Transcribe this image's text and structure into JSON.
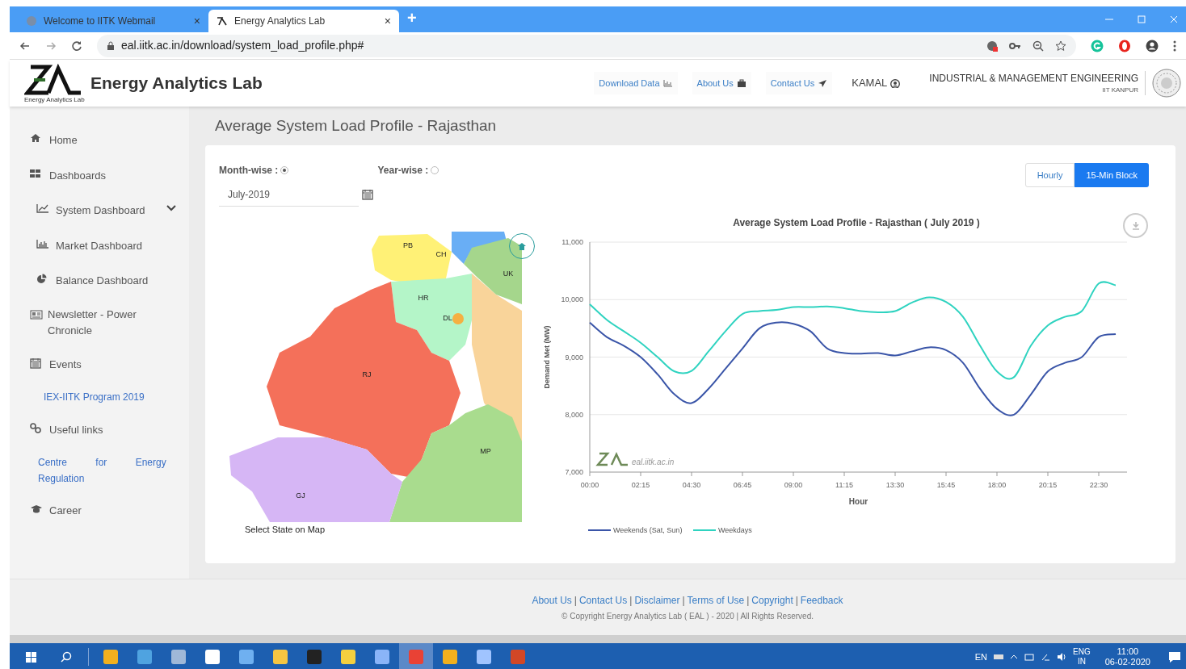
{
  "browser": {
    "tabs": [
      {
        "title": "Welcome to IITK Webmail",
        "selected": false
      },
      {
        "title": "Energy Analytics Lab",
        "selected": true
      }
    ],
    "tab_close": "×",
    "new_tab": "+",
    "url": "eal.iitk.ac.in/download/system_load_profile.php#"
  },
  "header": {
    "brand": "Energy Analytics Lab",
    "logo_caption": "Energy Analytics Lab",
    "nav": [
      {
        "label": "Download Data",
        "kind": "chart"
      },
      {
        "label": "About Us",
        "kind": "briefcase"
      },
      {
        "label": "Contact Us",
        "kind": "plane"
      },
      {
        "label": "KAMAL",
        "kind": "user"
      }
    ],
    "department": "INDUSTRIAL & MANAGEMENT ENGINEERING",
    "institute": "IIT KANPUR"
  },
  "sidebar": {
    "items": [
      {
        "label": "Home",
        "kind": "item"
      },
      {
        "label": "Dashboards",
        "kind": "item"
      },
      {
        "label": "System Dashboard",
        "kind": "sub",
        "expanded": false
      },
      {
        "label": "Market Dashboard",
        "kind": "sub"
      },
      {
        "label": "Balance Dashboard",
        "kind": "sub"
      },
      {
        "label": "Newsletter - Power Chronicle",
        "kind": "item"
      },
      {
        "label": "Events",
        "kind": "item"
      },
      {
        "label": "IEX-IITK Program 2019",
        "kind": "link"
      },
      {
        "label": "Useful links",
        "kind": "item"
      },
      {
        "label": "Centre for Energy Regulation",
        "kind": "link"
      },
      {
        "label": "Career",
        "kind": "item"
      }
    ]
  },
  "page_title": "Average System Load Profile - Rajasthan",
  "filters": {
    "options": [
      {
        "label": "Month-wise :",
        "selected": true
      },
      {
        "label": "Year-wise :",
        "selected": false
      }
    ],
    "month": "July-2019"
  },
  "resolution_buttons": [
    {
      "label": "Hourly",
      "selected": false
    },
    {
      "label": "15-Min Block",
      "selected": true
    }
  ],
  "map": {
    "caption": "Select State on Map",
    "states": [
      {
        "label": "PB",
        "color": "#fff176"
      },
      {
        "label": "CH",
        "color": "#fff176"
      },
      {
        "label": "UK",
        "color": "#a5d68c"
      },
      {
        "label": "HR",
        "color": "#b4f5c8"
      },
      {
        "label": "DL",
        "color": "#f5b042"
      },
      {
        "label": "RJ",
        "color": "#f4705a"
      },
      {
        "label": "MP",
        "color": "#a9dc8e"
      },
      {
        "label": "GJ",
        "color": "#d6b6f5"
      }
    ]
  },
  "chart": {
    "watermark": "eal.iitk.ac.in",
    "chart_data": {
      "type": "line",
      "title": "Average System Load Profile - Rajasthan ( July 2019 )",
      "xlabel": "Hour",
      "ylabel": "Demand Met (MW)",
      "x": [
        0,
        0.75,
        1.5,
        2.25,
        3,
        3.75,
        4.5,
        5.25,
        6,
        6.75,
        7.5,
        8.25,
        9,
        9.75,
        10.5,
        11.25,
        12,
        12.75,
        13.5,
        14.25,
        15,
        15.75,
        16.5,
        17.25,
        18,
        18.75,
        19.5,
        20.25,
        21,
        21.75,
        22.5,
        23.25
      ],
      "series": [
        {
          "name": "Weekends (Sat, Sun)",
          "color": "#3a55a8",
          "values": [
            9600,
            9350,
            9200,
            9000,
            8700,
            8350,
            8200,
            8450,
            8800,
            9150,
            9500,
            9600,
            9580,
            9450,
            9150,
            9070,
            9060,
            9070,
            9030,
            9100,
            9170,
            9120,
            8900,
            8450,
            8100,
            8000,
            8350,
            8750,
            8900,
            9000,
            9350,
            9400
          ]
        },
        {
          "name": "Weekdays",
          "color": "#2fd3c0",
          "values": [
            9920,
            9650,
            9450,
            9250,
            9000,
            8750,
            8760,
            9100,
            9450,
            9750,
            9800,
            9820,
            9870,
            9870,
            9880,
            9850,
            9800,
            9780,
            9800,
            9950,
            10040,
            9960,
            9700,
            9200,
            8750,
            8650,
            9200,
            9550,
            9700,
            9800,
            10280,
            10250
          ]
        }
      ],
      "grid": true,
      "legend": true,
      "xlim": [
        0,
        23.75
      ],
      "ylim": [
        7000,
        11000
      ],
      "xticks": [
        {
          "value": 0,
          "label": "00:00"
        },
        {
          "value": 2.25,
          "label": "02:15"
        },
        {
          "value": 4.5,
          "label": "04:30"
        },
        {
          "value": 6.75,
          "label": "06:45"
        },
        {
          "value": 9,
          "label": "09:00"
        },
        {
          "value": 11.25,
          "label": "11:15"
        },
        {
          "value": 13.5,
          "label": "13:30"
        },
        {
          "value": 15.75,
          "label": "15:45"
        },
        {
          "value": 18,
          "label": "18:00"
        },
        {
          "value": 20.25,
          "label": "20:15"
        },
        {
          "value": 22.5,
          "label": "22:30"
        }
      ],
      "yticks": [
        {
          "value": 7000,
          "label": "7,000"
        },
        {
          "value": 8000,
          "label": "8,000"
        },
        {
          "value": 9000,
          "label": "9,000"
        },
        {
          "value": 10000,
          "label": "10,000"
        },
        {
          "value": 11000,
          "label": "11,000"
        }
      ]
    }
  },
  "footer": {
    "separator": "|",
    "links": [
      "About Us",
      "Contact Us",
      "Disclaimer",
      "Terms of Use",
      "Copyright",
      "Feedback"
    ],
    "copyright": "© Copyright Energy Analytics Lab ( EAL ) - 2020 | All Rights Reserved."
  },
  "taskbar": {
    "apps": [
      {
        "color": "#f2b01e",
        "selected": false
      },
      {
        "color": "#4fa3e0",
        "selected": false
      },
      {
        "color": "#9fb8d8",
        "selected": false
      },
      {
        "color": "#ffffff",
        "selected": false
      },
      {
        "color": "#6fb0f0",
        "selected": false
      },
      {
        "color": "#f5c542",
        "selected": false
      },
      {
        "color": "#222222",
        "selected": false
      },
      {
        "color": "#f4d03f",
        "selected": false
      },
      {
        "color": "#8ab4f8",
        "selected": false
      },
      {
        "color": "#e94235",
        "selected": true
      },
      {
        "color": "#f2b01e",
        "selected": false
      },
      {
        "color": "#a0c4ff",
        "selected": false
      },
      {
        "color": "#d24726",
        "selected": false
      }
    ],
    "tray": {
      "keyboard": "EN",
      "language": "ENG",
      "region": "IN",
      "time": "11:00",
      "date": "06-02-2020"
    }
  }
}
